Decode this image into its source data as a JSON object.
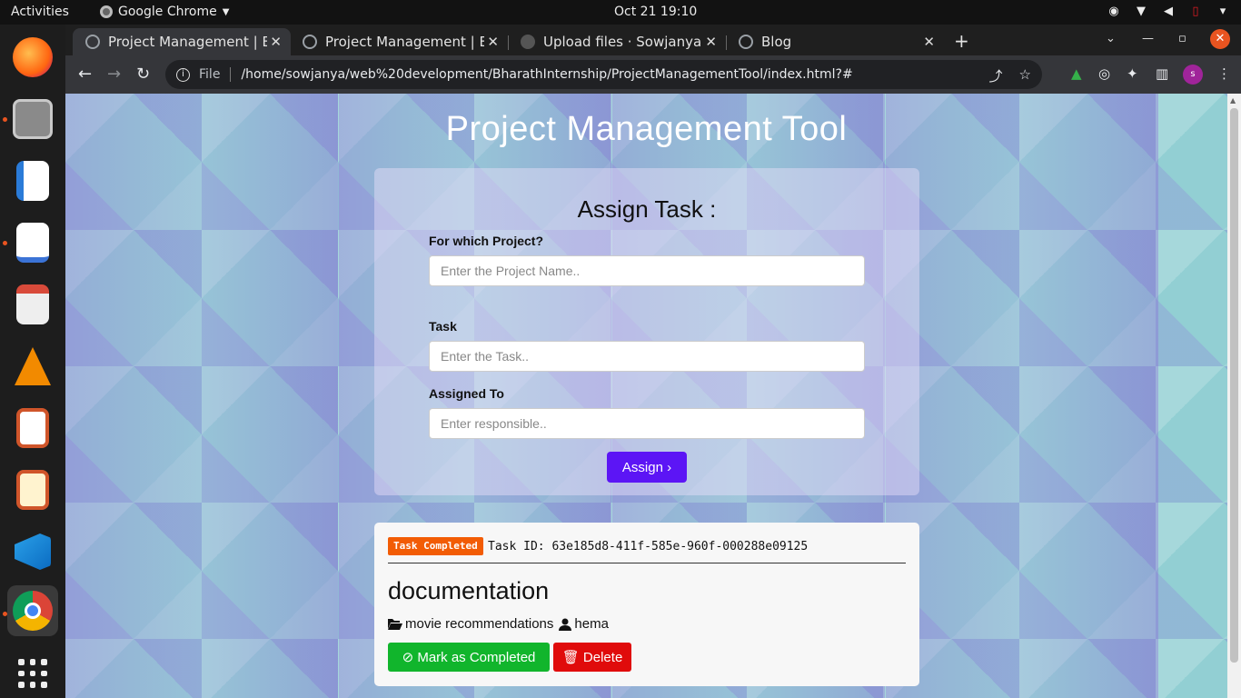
{
  "system": {
    "activities": "Activities",
    "app_name": "Google Chrome",
    "clock": "Oct 21  19:10"
  },
  "browser": {
    "tabs": [
      {
        "title": "Project Management | Bh",
        "close": "✕"
      },
      {
        "title": "Project Management | Bh",
        "close": "✕"
      },
      {
        "title": "Upload files · SowjanyaPa",
        "close": "✕"
      },
      {
        "title": "Blog",
        "close": "✕"
      }
    ],
    "omnibox": {
      "scheme_label": "File",
      "url": "/home/sowjanya/web%20development/BharathInternship/ProjectManagementTool/index.html?#"
    },
    "profile_initial": "s"
  },
  "page": {
    "title": "Project Management Tool",
    "form": {
      "heading": "Assign Task :",
      "project_label": "For which Project?",
      "project_placeholder": "Enter the Project Name..",
      "task_label": "Task",
      "task_placeholder": "Enter the Task..",
      "assigned_label": "Assigned To",
      "assigned_placeholder": "Enter responsible..",
      "assign_button": "Assign"
    },
    "task": {
      "status_badge": "Task Completed",
      "task_id": "Task ID: 63e185d8-411f-585e-960f-000288e09125",
      "title": "documentation",
      "project": "movie recommendations",
      "assignee": "hema",
      "complete_button": "Mark as Completed",
      "delete_button": "Delete"
    }
  }
}
